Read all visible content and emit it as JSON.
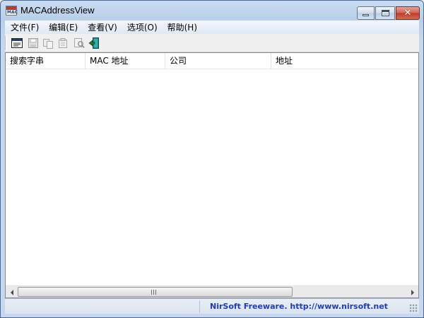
{
  "window": {
    "title": "MACAddressView",
    "icon_name": "mac-app-icon",
    "icon_text": "MAC",
    "controls": {
      "minimize": "minimize-icon",
      "maximize": "maximize-icon",
      "close": "close-icon",
      "close_glyph": "✕"
    }
  },
  "menu": {
    "items": [
      {
        "label": "文件(F)"
      },
      {
        "label": "编辑(E)"
      },
      {
        "label": "查看(V)"
      },
      {
        "label": "选项(O)"
      },
      {
        "label": "帮助(H)"
      }
    ]
  },
  "toolbar": {
    "buttons": [
      {
        "icon": "html-report-icon",
        "enabled": true
      },
      {
        "icon": "save-icon",
        "enabled": false
      },
      {
        "icon": "copy-icon",
        "enabled": false
      },
      {
        "icon": "properties-icon",
        "enabled": false
      },
      {
        "icon": "find-icon",
        "enabled": false
      },
      {
        "icon": "exit-icon",
        "enabled": true
      }
    ]
  },
  "list": {
    "columns": [
      {
        "label": "搜索字串"
      },
      {
        "label": "MAC 地址"
      },
      {
        "label": "公司"
      },
      {
        "label": "地址"
      }
    ],
    "rows": []
  },
  "statusbar": {
    "left_text": "",
    "link_text": "NirSoft Freeware.  http://www.nirsoft.net",
    "link_color": "#1a3cc9"
  },
  "colors": {
    "close_button": "#c03b27",
    "window_frame": "#c5d8ef"
  }
}
